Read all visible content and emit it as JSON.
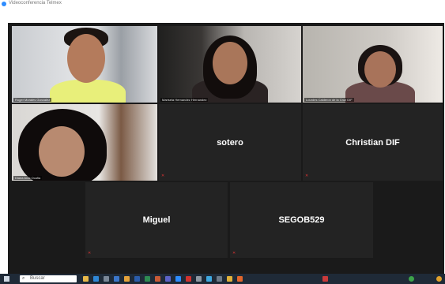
{
  "window": {
    "title": "Videoconferencia Telmex"
  },
  "participants": [
    {
      "name": "Roger Morales Gonzalez",
      "video": true
    },
    {
      "name": "Marisela Hernandez Hernandez",
      "video": true
    },
    {
      "name": "Lourdes Calderon de la Cruz DIF",
      "video": true
    },
    {
      "name": "Diana Anai Ocaña",
      "video": true
    },
    {
      "name": "sotero",
      "video": false
    },
    {
      "name": "Christian DIF",
      "video": false
    },
    {
      "name": "Miguel",
      "video": false
    },
    {
      "name": "SEGOB529",
      "video": false
    }
  ],
  "taskbar": {
    "search_placeholder": "Buscar",
    "icons": [
      "file-explorer-icon",
      "edge-icon",
      "store-icon",
      "mail-icon",
      "chrome-icon",
      "word-icon",
      "excel-icon",
      "powerpoint-icon",
      "teams-icon",
      "zoom-icon",
      "pdf-icon",
      "settings-icon",
      "photos-icon",
      "calendar-icon",
      "chrome-icon",
      "firefox-icon"
    ]
  },
  "colors": {
    "active_speaker_border": "#d7e12a",
    "stage_background": "#1a1a1a",
    "tile_background": "#232323",
    "taskbar": "#1f2a37"
  }
}
